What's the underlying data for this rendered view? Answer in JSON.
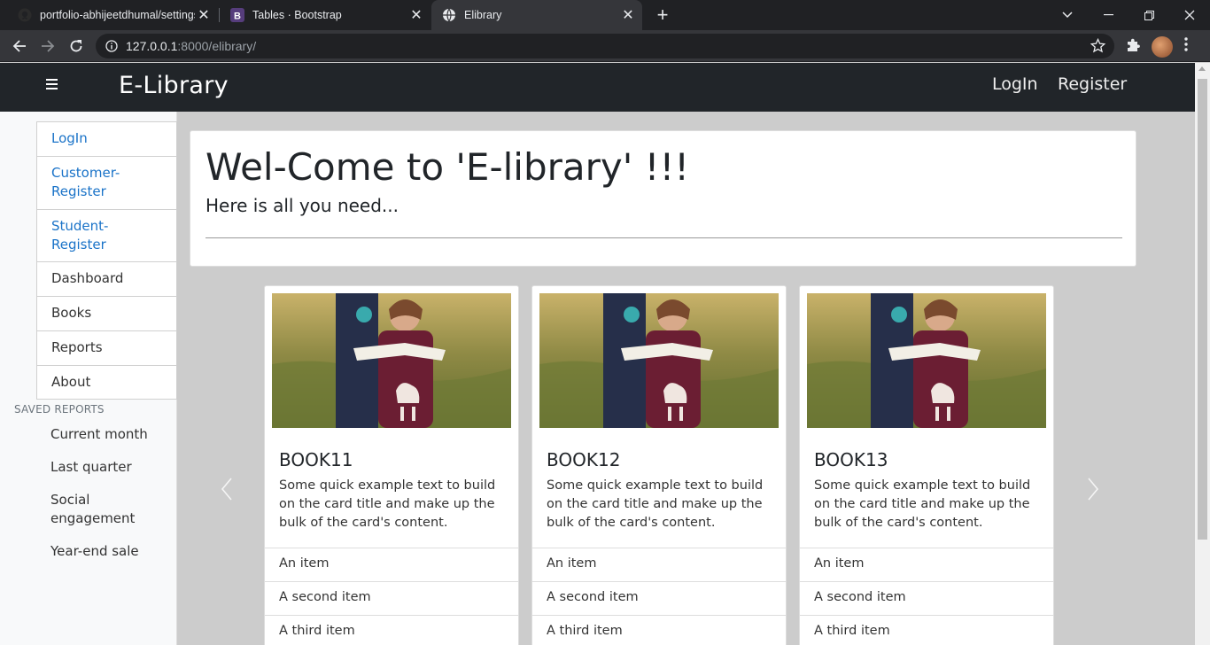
{
  "browser": {
    "tabs": [
      {
        "title": "portfolio-abhijeetdhumal/settings",
        "favicon": "github-icon"
      },
      {
        "title": "Tables · Bootstrap",
        "favicon": "bootstrap-icon"
      },
      {
        "title": "Elibrary",
        "favicon": "globe-icon",
        "active": true
      }
    ],
    "url_host": "127.0.0.1",
    "url_path": ":8000/elibrary/"
  },
  "navbar": {
    "brand": "E-Library",
    "login": "LogIn",
    "register": "Register"
  },
  "sidebar": {
    "items": [
      {
        "label": "LogIn",
        "link": true
      },
      {
        "label": "Customer-Register",
        "link": true
      },
      {
        "label": "Student-Register",
        "link": true
      },
      {
        "label": "Dashboard",
        "link": false
      },
      {
        "label": "Books",
        "link": false
      },
      {
        "label": "Reports",
        "link": false
      },
      {
        "label": "About",
        "link": false
      }
    ],
    "saved_reports_title": "SAVED REPORTS",
    "saved_reports": [
      "Current month",
      "Last quarter",
      "Social engagement",
      "Year-end sale"
    ]
  },
  "jumbotron": {
    "heading": "Wel-Come to 'E-library' !!!",
    "lead": "Here is all you need..."
  },
  "cards": [
    {
      "title": "BOOK11",
      "text": "Some quick example text to build on the card title and make up the bulk of the card's content.",
      "items": [
        "An item",
        "A second item",
        "A third item"
      ]
    },
    {
      "title": "BOOK12",
      "text": "Some quick example text to build on the card title and make up the bulk of the card's content.",
      "items": [
        "An item",
        "A second item",
        "A third item"
      ]
    },
    {
      "title": "BOOK13",
      "text": "Some quick example text to build on the card title and make up the bulk of the card's content.",
      "items": [
        "An item",
        "A second item",
        "A third item"
      ]
    }
  ],
  "colors": {
    "navbar_bg": "#212529",
    "link": "#1a73c8",
    "page_bg": "#cccccc"
  }
}
